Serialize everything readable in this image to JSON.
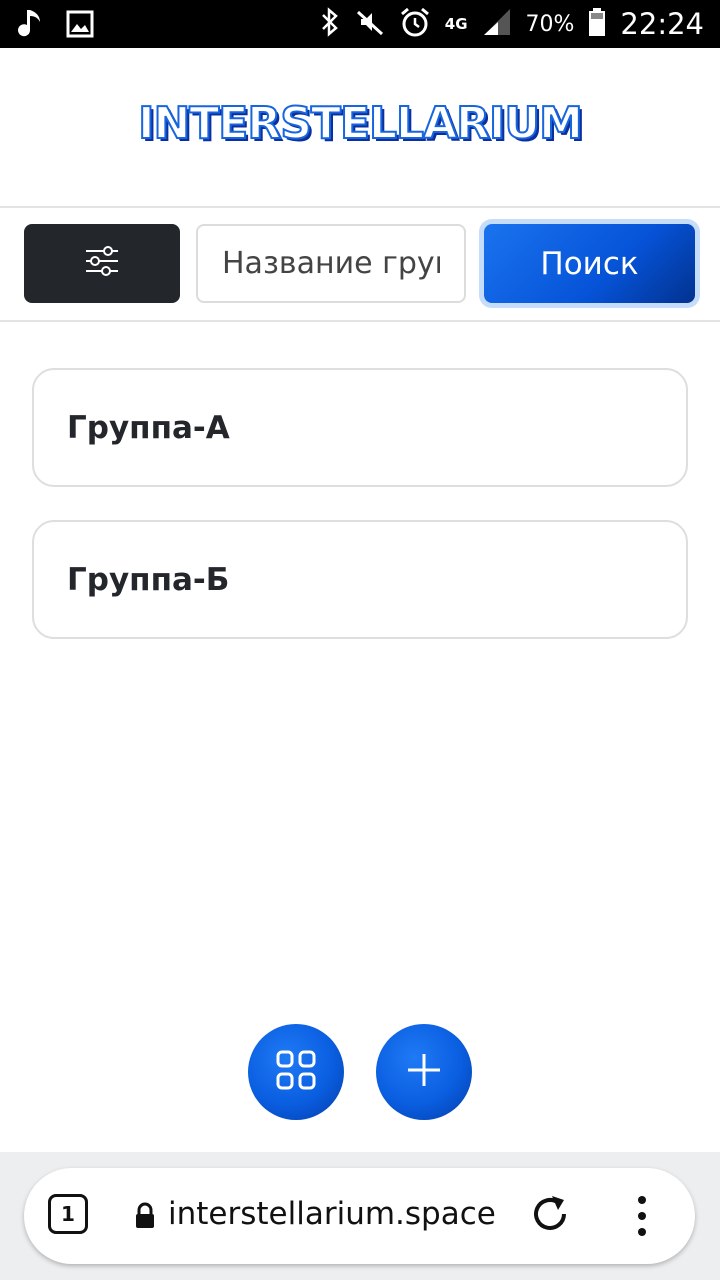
{
  "status_bar": {
    "battery": "70%",
    "time": "22:24",
    "network": "4G",
    "icons": [
      "music-note-icon",
      "image-icon",
      "bluetooth-icon",
      "mute-icon",
      "alarm-icon",
      "signal-icon",
      "battery-icon"
    ]
  },
  "header": {
    "logo": "INTERSTELLARIUM"
  },
  "toolbar": {
    "filter_icon": "sliders-icon",
    "search_placeholder": "Название группы",
    "search_label": "Поиск"
  },
  "groups": [
    {
      "name": "Группа-А"
    },
    {
      "name": "Группа-Б"
    }
  ],
  "fabs": {
    "grid_icon": "grid-icon",
    "add_icon": "plus-icon"
  },
  "browser": {
    "tab_count": "1",
    "url": "interstellarium.space"
  },
  "colors": {
    "primary": "#0a5ee0",
    "dark": "#23262b",
    "border": "#dedede"
  }
}
